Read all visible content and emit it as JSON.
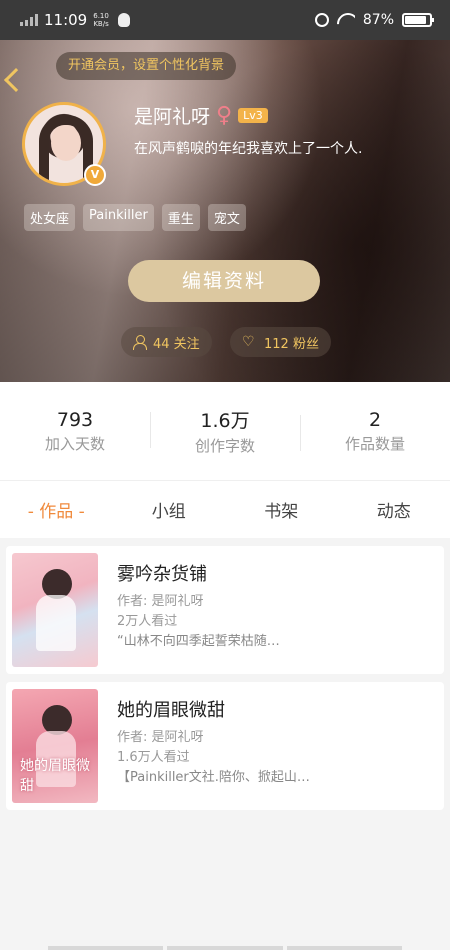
{
  "status_bar": {
    "time": "11:09",
    "net_speed_value": "6.10",
    "net_speed_unit": "KB/s",
    "battery": "87%",
    "battery_level": 0.87
  },
  "header": {
    "vip_prompt": "开通会员，设置个性化背景",
    "username": "是阿礼呀",
    "gender_symbol": "♀",
    "level": "Lv3",
    "verified_mark": "V",
    "bio": "在风声鹤唳的年纪我喜欢上了一个人.",
    "tags": [
      "处女座",
      "Painkiller",
      "重生",
      "宠文"
    ],
    "edit_button": "编辑资料",
    "following_label": "44 关注",
    "fans_label": "112 粉丝"
  },
  "stats": [
    {
      "value": "793",
      "label": "加入天数"
    },
    {
      "value": "1.6万",
      "label": "创作字数"
    },
    {
      "value": "2",
      "label": "作品数量"
    }
  ],
  "tabs": [
    {
      "label": "- 作品 -",
      "active": true
    },
    {
      "label": "小组",
      "active": false
    },
    {
      "label": "书架",
      "active": false
    },
    {
      "label": "动态",
      "active": false
    }
  ],
  "works": [
    {
      "title": "雾吟杂货铺",
      "author": "作者: 是阿礼呀",
      "views": "2万人看过",
      "excerpt": "“山林不向四季起誓荣枯随…"
    },
    {
      "title": "她的眉眼微甜",
      "author": "作者: 是阿礼呀",
      "views": "1.6万人看过",
      "excerpt": "【Painkiller文社.陪你、掀起山…",
      "cover_text": "她的眉眼微甜"
    }
  ],
  "colors": {
    "accent": "#f08a3c",
    "gold": "#f0c560",
    "edit_button": "#dcc8a0"
  }
}
